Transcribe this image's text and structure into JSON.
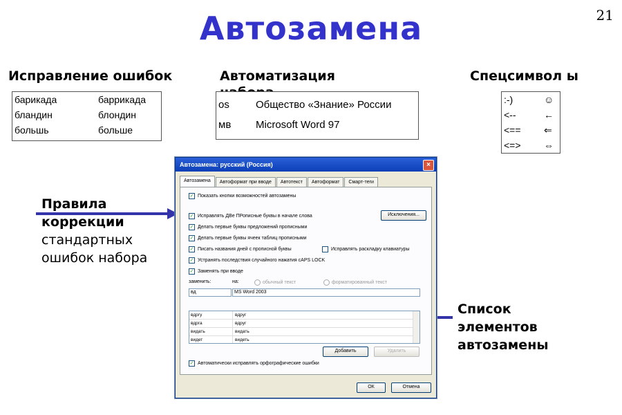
{
  "title": "Автозамена",
  "page_number": "21",
  "sections": {
    "errors_heading": "Исправление ошибок",
    "automation_heading": "Автоматизация набора",
    "specials_heading": "Спецсимвол ы"
  },
  "errors_table": [
    {
      "from": "барикада",
      "to": "баррикада"
    },
    {
      "from": "бландин",
      "to": "блондин"
    },
    {
      "from": "большь",
      "to": "больше"
    }
  ],
  "automation_table": [
    {
      "from": " os",
      "to": "Общество «Знание» России"
    },
    {
      "from": "мв",
      "to": "Microsoft Word 97"
    }
  ],
  "specials_table": [
    {
      "from": ":-)",
      "to": "☺"
    },
    {
      "from": "<--",
      "to": "←"
    },
    {
      "from": "<==",
      "to": "⇐"
    },
    {
      "from": "<=>",
      "to": "⇔"
    }
  ],
  "left_callout": {
    "bold_line1": "Правила",
    "bold_line2": "коррекции",
    "line3": "стандартных",
    "line4": "ошибок набора"
  },
  "right_callout": {
    "line1": "Список",
    "line2": "элементов",
    "line3": "автозамены"
  },
  "dialog": {
    "title": "Автозамена: русский (Россия)",
    "close_icon": "×",
    "tabs": [
      "Автозамена",
      "Автоформат при вводе",
      "Автотекст",
      "Автоформат",
      "Смарт-теги"
    ],
    "options": [
      "Показать кнопки возможностей автозамены",
      "Исправлять ДВе ПРописные буквы в начале слова",
      "Делать первые буквы предложений прописными",
      "Делать первые буквы ячеек таблиц прописными",
      "Писать названия дней с прописной буквы",
      "Устранять последствия случайного нажатия cAPS LOCK",
      "Заменять при вводе"
    ],
    "keyboard_option": "Исправлять раскладку клавиатуры",
    "exceptions_button": "Исключения...",
    "replace_label": "заменить:",
    "with_label": "на:",
    "plain_text_label": "обычный текст",
    "formatted_text_label": "форматированный текст",
    "replace_value": "вд",
    "with_value": "MS Word 2003",
    "list_rows": [
      {
        "from": "вдргу",
        "to": "вдруг"
      },
      {
        "from": "вдрга",
        "to": "вдруг"
      },
      {
        "from": "видать",
        "to": "видать"
      },
      {
        "from": "видет",
        "to": "видеть"
      }
    ],
    "add_button": "Добавить",
    "delete_button": "Удалить",
    "spell_option": "Автоматически исправлять орфографические ошибки",
    "ok_button": "ОК",
    "cancel_button": "Отмена"
  },
  "colors": {
    "title": "#3333cc",
    "arrow": "#3333aa",
    "dialog_title_bar": "#0b3fb7"
  }
}
